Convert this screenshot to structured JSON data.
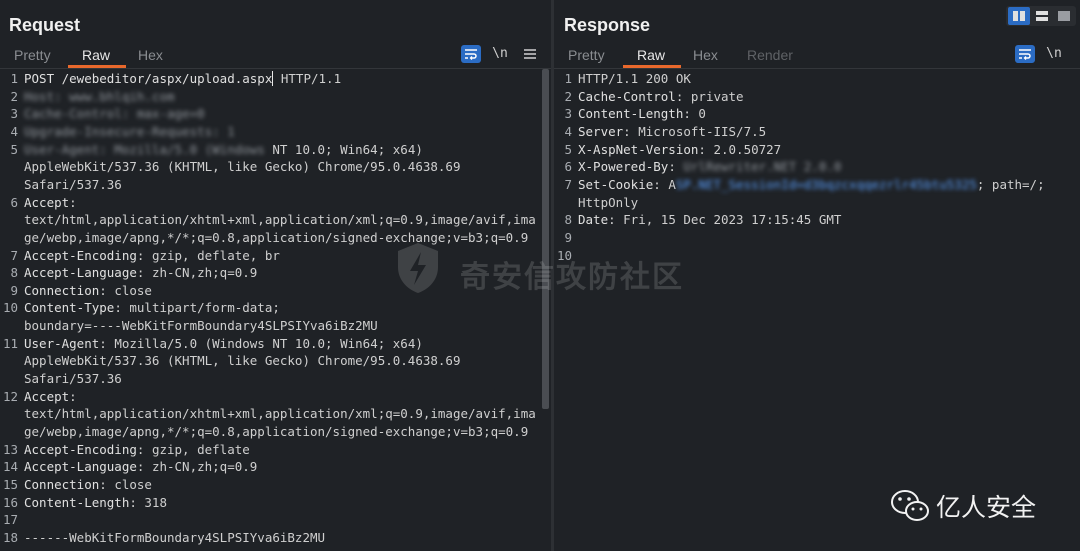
{
  "request": {
    "title": "Request",
    "tabs": [
      "Pretty",
      "Raw",
      "Hex"
    ],
    "active_tab": "Raw",
    "tools": {
      "wrap": "≡",
      "newline": "\\n",
      "menu": "≡"
    },
    "lines": [
      {
        "n": "1",
        "name": "POST /ewebeditor/aspx/upload.aspx",
        "value": " HTTP/1.1",
        "cursor": true
      },
      {
        "n": "2",
        "redacted": "Host: www.bhlqih.com"
      },
      {
        "n": "3",
        "redacted": "Cache-Control: max-age=0"
      },
      {
        "n": "4",
        "redacted": "Upgrade-Insecure-Requests: 1"
      },
      {
        "n": "5",
        "redacted": "User-Agent: Mozilla/5.0 (Windows",
        "value": " NT 10.0; Win64; x64)"
      },
      {
        "n": "",
        "value": "AppleWebKit/537.36 (KHTML, like Gecko) Chrome/95.0.4638.69"
      },
      {
        "n": "",
        "value": "Safari/537.36"
      },
      {
        "n": "6",
        "name": "Accept",
        "value": ":"
      },
      {
        "n": "",
        "value": "text/html,application/xhtml+xml,application/xml;q=0.9,image/avif,ima"
      },
      {
        "n": "",
        "value": "ge/webp,image/apng,*/*;q=0.8,application/signed-exchange;v=b3;q=0.9"
      },
      {
        "n": "7",
        "name": "Accept-Encoding",
        "value": ": gzip, deflate, br"
      },
      {
        "n": "8",
        "name": "Accept-Language",
        "value": ": zh-CN,zh;q=0.9"
      },
      {
        "n": "9",
        "name": "Connection",
        "value": ": close"
      },
      {
        "n": "10",
        "name": "Content-Type",
        "value": ": multipart/form-data;"
      },
      {
        "n": "",
        "value": "boundary=----WebKitFormBoundary4SLPSIYva6iBz2MU"
      },
      {
        "n": "11",
        "name": "User-Agent",
        "value": ": Mozilla/5.0 (Windows NT 10.0; Win64; x64)"
      },
      {
        "n": "",
        "value": "AppleWebKit/537.36 (KHTML, like Gecko) Chrome/95.0.4638.69"
      },
      {
        "n": "",
        "value": "Safari/537.36"
      },
      {
        "n": "12",
        "name": "Accept",
        "value": ":"
      },
      {
        "n": "",
        "value": "text/html,application/xhtml+xml,application/xml;q=0.9,image/avif,ima"
      },
      {
        "n": "",
        "value": "ge/webp,image/apng,*/*;q=0.8,application/signed-exchange;v=b3;q=0.9"
      },
      {
        "n": "13",
        "name": "Accept-Encoding",
        "value": ": gzip, deflate"
      },
      {
        "n": "14",
        "name": "Accept-Language",
        "value": ": zh-CN,zh;q=0.9"
      },
      {
        "n": "15",
        "name": "Connection",
        "value": ": close"
      },
      {
        "n": "16",
        "name": "Content-Length",
        "value": ": 318"
      },
      {
        "n": "17",
        "value": ""
      },
      {
        "n": "18",
        "value": "------WebKitFormBoundary4SLPSIYva6iBz2MU"
      }
    ]
  },
  "response": {
    "title": "Response",
    "tabs": [
      "Pretty",
      "Raw",
      "Hex",
      "Render"
    ],
    "active_tab": "Raw",
    "tools": {
      "wrap": "≡",
      "newline": "\\n"
    },
    "lines": [
      {
        "n": "1",
        "value": "HTTP/1.1 200 OK"
      },
      {
        "n": "2",
        "name": "Cache-Control",
        "value": ": private"
      },
      {
        "n": "3",
        "name": "Content-Length",
        "value": ": 0"
      },
      {
        "n": "4",
        "name": "Server",
        "value": ": Microsoft-IIS/7.5"
      },
      {
        "n": "5",
        "name": "X-AspNet-Version",
        "value": ": 2.0.50727"
      },
      {
        "n": "6",
        "name": "X-Powered-By",
        "value": ": ",
        "redacted": "UrlRewriter.NET 2.0.0"
      },
      {
        "n": "7",
        "name": "Set-Cookie",
        "value": ": A",
        "redacted_blue": "SP.NET_SessionId=d3bqzcxqqezrlr45btu5325",
        "tail": "; path=/;"
      },
      {
        "n": "",
        "value": "HttpOnly"
      },
      {
        "n": "8",
        "name": "Date",
        "value": ": Fri, 15 Dec 2023 17:15:45 GMT"
      },
      {
        "n": "9",
        "value": ""
      },
      {
        "n": "10",
        "value": ""
      }
    ]
  },
  "watermark": "奇安信攻防社区",
  "wechat_label": "亿人安全",
  "colors": {
    "accent": "#e8682c",
    "toolbar_blue": "#2b6cc4",
    "background": "#1f2226"
  }
}
